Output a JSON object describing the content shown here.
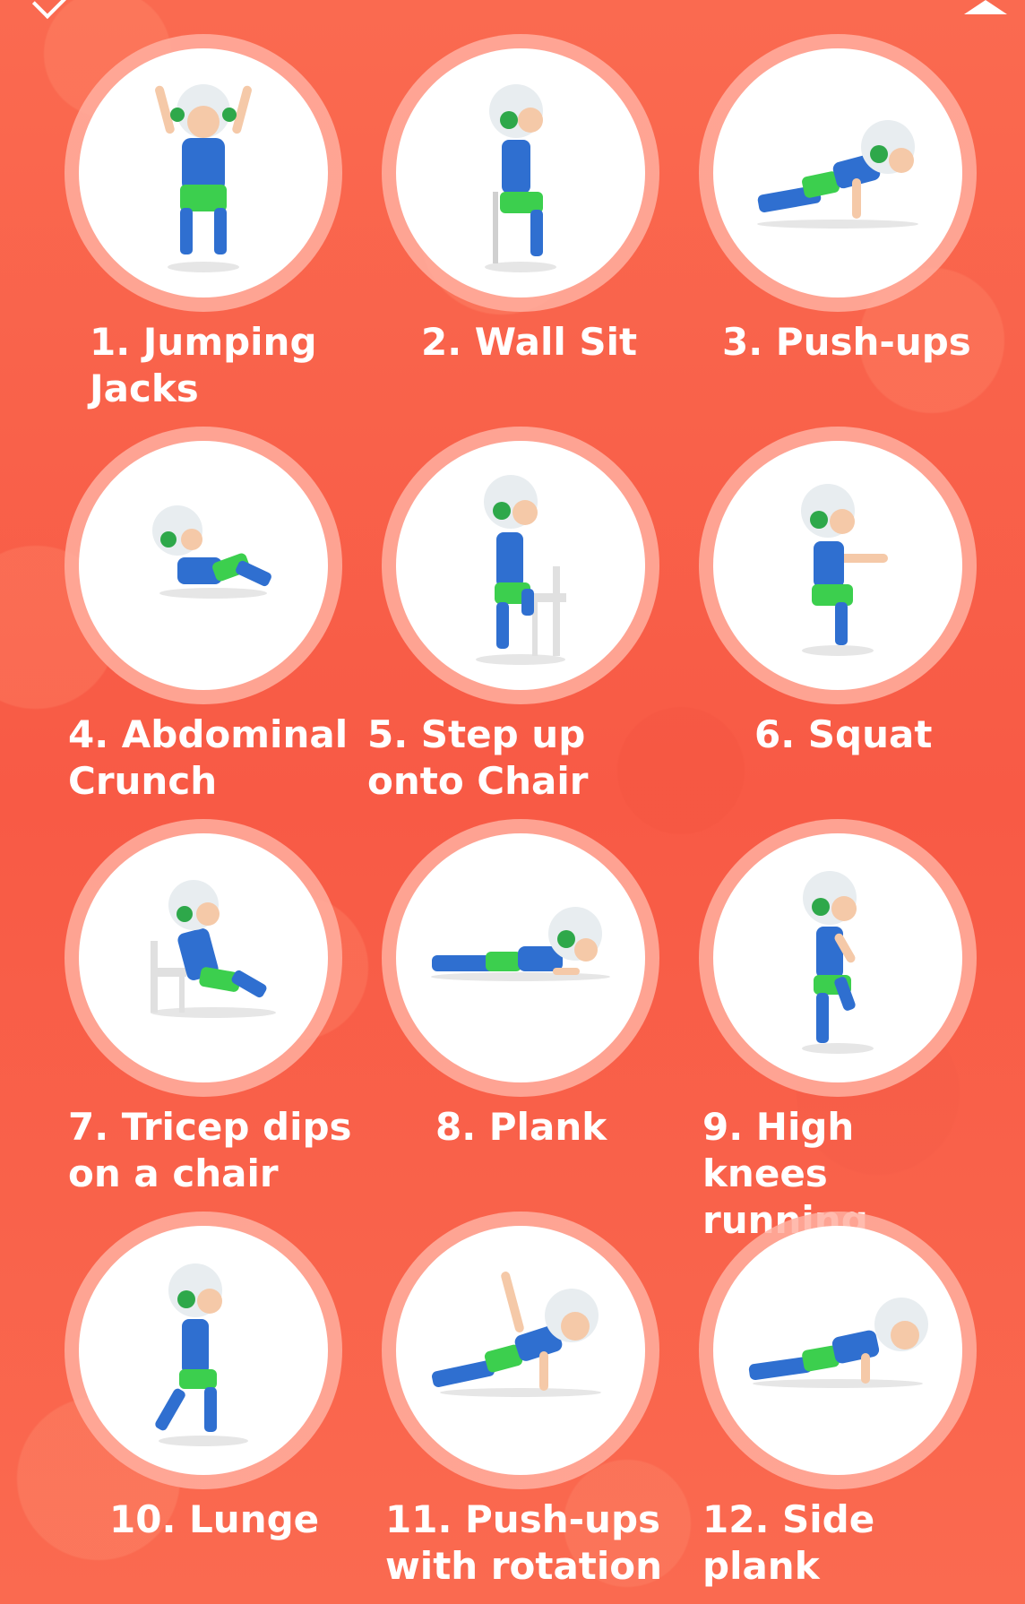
{
  "exercises": [
    {
      "label": "1. Jumping Jacks",
      "icon": "jumping-jacks-figure-icon"
    },
    {
      "label": "2. Wall Sit",
      "icon": "wall-sit-figure-icon"
    },
    {
      "label": "3. Push-ups",
      "icon": "push-ups-figure-icon"
    },
    {
      "label": "4. Abdominal Crunch",
      "icon": "abdominal-crunch-figure-icon"
    },
    {
      "label": "5. Step up onto Chair",
      "icon": "step-up-figure-icon"
    },
    {
      "label": "6. Squat",
      "icon": "squat-figure-icon"
    },
    {
      "label": "7. Tricep dips on a chair",
      "icon": "tricep-dips-figure-icon"
    },
    {
      "label": "8. Plank",
      "icon": "plank-figure-icon"
    },
    {
      "label": "9. High knees running",
      "icon": "high-knees-figure-icon"
    },
    {
      "label": "10. Lunge",
      "icon": "lunge-figure-icon"
    },
    {
      "label": "11. Push-ups with rotation",
      "icon": "push-up-rotation-figure-icon"
    },
    {
      "label": "12. Side plank",
      "icon": "side-plank-figure-icon"
    }
  ],
  "colors": {
    "background": "#f9644d",
    "ring": "#ffafa0",
    "shirt": "#2f6fd0",
    "shorts": "#3ccf4e",
    "helmet": "#e8edf0",
    "skin": "#f5c9a8",
    "hair": "#5a3620"
  }
}
